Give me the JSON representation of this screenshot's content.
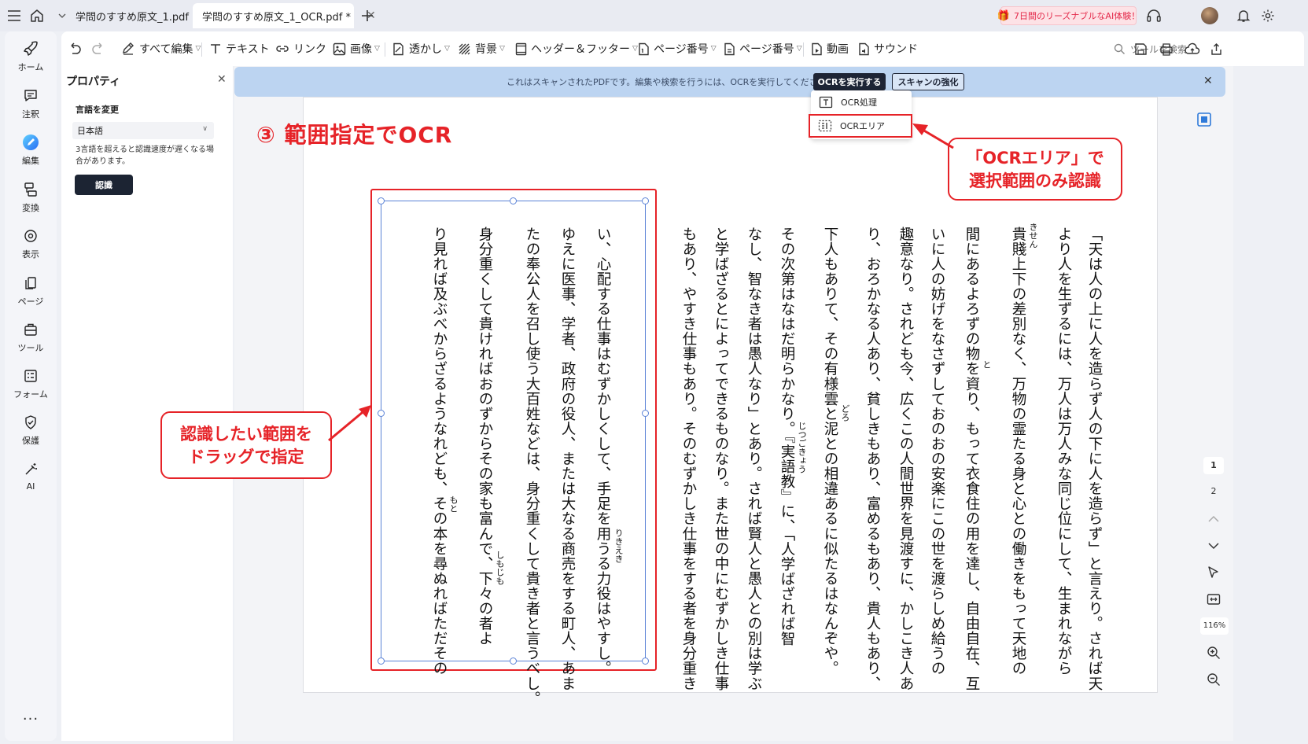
{
  "titlebar": {
    "tabs": [
      {
        "label": "学問のすすめ原文_1.pdf",
        "active": false
      },
      {
        "label": "学問のすすめ原文_1_OCR.pdf *",
        "active": true
      }
    ],
    "promo": "7日間のリーズナブルなAI体験！"
  },
  "toolbar": {
    "items": [
      {
        "label": "すべて編集",
        "icon": "edit-all-icon",
        "caret": true
      },
      {
        "label": "テキスト",
        "icon": "text-icon",
        "caret": false
      },
      {
        "label": "リンク",
        "icon": "link-icon",
        "caret": false
      },
      {
        "label": "画像",
        "icon": "image-icon",
        "caret": true
      },
      {
        "label": "透かし",
        "icon": "watermark-icon",
        "caret": true
      },
      {
        "label": "背景",
        "icon": "background-icon",
        "caret": true
      },
      {
        "label": "ヘッダー＆フッター",
        "icon": "header-footer-icon",
        "caret": true
      },
      {
        "label": "ページ番号",
        "icon": "page-number-icon",
        "caret": true
      },
      {
        "label": "ページ番号",
        "icon": "bates-number-icon",
        "caret": true
      },
      {
        "label": "動画",
        "icon": "video-icon",
        "caret": false
      },
      {
        "label": "サウンド",
        "icon": "sound-icon",
        "caret": false
      }
    ],
    "search_placeholder": "ツールを検索"
  },
  "sidebar": {
    "items": [
      {
        "label": "ホーム",
        "icon": "home-rocket-icon",
        "active": false
      },
      {
        "label": "注釈",
        "icon": "comment-icon",
        "active": false
      },
      {
        "label": "編集",
        "icon": "edit-icon",
        "active": true
      },
      {
        "label": "変換",
        "icon": "convert-icon",
        "active": false
      },
      {
        "label": "表示",
        "icon": "view-icon",
        "active": false
      },
      {
        "label": "ページ",
        "icon": "pages-icon",
        "active": false
      },
      {
        "label": "ツール",
        "icon": "tools-icon",
        "active": false
      },
      {
        "label": "フォーム",
        "icon": "form-icon",
        "active": false
      },
      {
        "label": "保護",
        "icon": "shield-icon",
        "active": false
      },
      {
        "label": "AI",
        "icon": "ai-wand-icon",
        "active": false
      }
    ],
    "more": "···"
  },
  "properties": {
    "title": "プロパティ",
    "section_label": "言語を変更",
    "language_value": "日本語",
    "note": "3言語を超えると認識速度が遅くなる場合があります。",
    "recognize_button": "認識"
  },
  "banner": {
    "message": "これはスキャンされたPDFです。編集や検索を行うには、OCRを実行してください。",
    "run_ocr": "OCRを実行する",
    "enhance_scan": "スキャンの強化"
  },
  "ocr_menu": {
    "items": [
      {
        "label": "OCR処理",
        "highlighted": false
      },
      {
        "label": "OCRエリア",
        "highlighted": true
      }
    ]
  },
  "annotations": {
    "step_title": "③ 範囲指定でOCR",
    "callout_area_line1": "「OCRエリア」で",
    "callout_area_line2": "選択範囲のみ認識",
    "callout_drag_line1": "認識したい範囲を",
    "callout_drag_line2": "ドラッグで指定"
  },
  "document": {
    "columns": [
      "「天は人の上に人を造らず人の下に人を造らず」と言えり。されば天",
      "より人を生ずるには、万人は万人みな同じ位にして、生まれながら",
      "貴賤上下の差別なく、万物の霊たる身と心との働きをもって天地の",
      "間にあるよろずの物を資り、もって衣食住の用を達し、自由自在、互",
      "いに人の妨げをなさずしておのおの安楽にこの世を渡らしめ給うの",
      "趣意なり。されども今、広くこの人間世界を見渡すに、かしこき人あ",
      "り、おろかなる人あり、貧しきもあり、富めるもあり、貴人もあり、",
      "下人もありて、その有様雲と泥との相違あるに似たるはなんぞや。",
      "その次第はなはだ明らかなり。『実語教』に、「人学ばざれば智",
      "なし、智なき者は愚人なり」とあり。されば賢人と愚人との別は学ぶ",
      "と学ばざるとによってできるものなり。また世の中にむずかしき仕事",
      "もあり、やすき仕事もあり。そのむずかしき仕事をする者を身分重き",
      "い、心配する仕事はむずかしくして、手足を用うる力役はやすし。",
      "ゆえに医事、学者、政府の役人、または大なる商売をする町人、あま",
      "たの奉公人を召し使う大百姓などは、身分重くして貴き者と言うべし。",
      "身分重くして貴ければおのずからその家も富んで、下々の者よ",
      "り見れば及ぶべからざるようなれども、その本を尋ぬればただその"
    ],
    "ruby": [
      {
        "text": "きせん"
      },
      {
        "text": "と"
      },
      {
        "text": "どろ"
      },
      {
        "text": "じつごきょう"
      },
      {
        "text": "りきえき"
      },
      {
        "text": "しもじも"
      },
      {
        "text": "もと"
      }
    ]
  },
  "rightbar": {
    "page_numbers": [
      "1",
      "2"
    ],
    "zoom": "116%"
  }
}
